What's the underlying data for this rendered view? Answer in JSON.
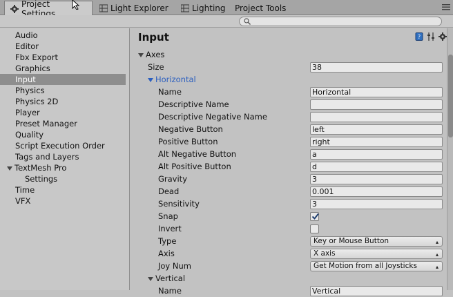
{
  "tabs": [
    {
      "label": "Project Settings",
      "icon": "gear-icon",
      "active": true
    },
    {
      "label": "Light Explorer",
      "icon": "grid-icon",
      "active": false
    },
    {
      "label": "Lighting",
      "icon": "grid-icon",
      "active": false
    },
    {
      "label": "Project Tools",
      "icon": "",
      "active": false
    }
  ],
  "sidebar": {
    "items": [
      {
        "label": "Audio"
      },
      {
        "label": "Editor"
      },
      {
        "label": "Fbx Export"
      },
      {
        "label": "Graphics"
      },
      {
        "label": "Input",
        "selected": true
      },
      {
        "label": "Physics"
      },
      {
        "label": "Physics 2D"
      },
      {
        "label": "Player"
      },
      {
        "label": "Preset Manager"
      },
      {
        "label": "Quality"
      },
      {
        "label": "Script Execution Order"
      },
      {
        "label": "Tags and Layers"
      },
      {
        "label": "TextMesh Pro",
        "group": true
      },
      {
        "label": "Settings",
        "child": true
      },
      {
        "label": "Time"
      },
      {
        "label": "VFX"
      }
    ]
  },
  "main": {
    "title": "Input",
    "axes_label": "Axes",
    "size_label": "Size",
    "size_value": "38",
    "horizontal_label": "Horizontal",
    "vertical_label": "Vertical",
    "fields": {
      "name": {
        "label": "Name",
        "value": "Horizontal"
      },
      "descriptive_name": {
        "label": "Descriptive Name",
        "value": ""
      },
      "descriptive_negative_name": {
        "label": "Descriptive Negative Name",
        "value": ""
      },
      "negative_button": {
        "label": "Negative Button",
        "value": "left"
      },
      "positive_button": {
        "label": "Positive Button",
        "value": "right"
      },
      "alt_negative_button": {
        "label": "Alt Negative Button",
        "value": "a"
      },
      "alt_positive_button": {
        "label": "Alt Positive Button",
        "value": "d"
      },
      "gravity": {
        "label": "Gravity",
        "value": "3"
      },
      "dead": {
        "label": "Dead",
        "value": "0.001"
      },
      "sensitivity": {
        "label": "Sensitivity",
        "value": "3"
      },
      "snap": {
        "label": "Snap",
        "checked": true
      },
      "invert": {
        "label": "Invert",
        "checked": false
      },
      "type": {
        "label": "Type",
        "value": "Key or Mouse Button"
      },
      "axis": {
        "label": "Axis",
        "value": "X axis"
      },
      "joy_num": {
        "label": "Joy Num",
        "value": "Get Motion from all Joysticks"
      }
    },
    "vertical_name": {
      "label": "Name",
      "value": "Vertical"
    }
  },
  "colors": {
    "accent_blue": "#2c5fbf",
    "selection": "#8e8e8e"
  }
}
